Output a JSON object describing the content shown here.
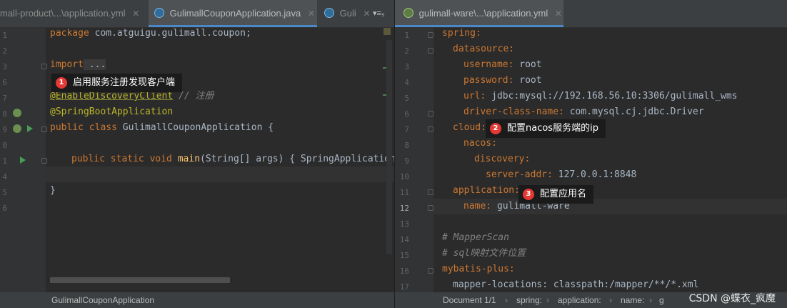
{
  "left_tabs": [
    {
      "label": "mall-product\\...\\application.yml",
      "active": false
    },
    {
      "label": "GulimallCouponApplication.java",
      "active": true
    },
    {
      "label": "Guli",
      "active": false
    }
  ],
  "left_tab_overflow": "▾≡₅",
  "right_tabs": [
    {
      "label": "gulimall-ware\\...\\application.yml",
      "active": true
    }
  ],
  "java": {
    "line_numbers": [
      "1",
      "2",
      "3",
      "6",
      "7",
      "8",
      "9",
      "0",
      "1",
      "4",
      "5",
      "6"
    ],
    "l1_kw": "package",
    "l1_rest": " com.atguigu.gulimall.coupon;",
    "l3_kw": "import",
    "l3_rest": " ...",
    "l7_ann": "@EnableDiscoveryClient",
    "l7_cmt": " // 注册",
    "l8_ann": "@SpringBootApplication",
    "l9_kw": "public class",
    "l9_rest": " GulimallCouponApplication {",
    "l11_kw": "public static void",
    "l11_fn": " main",
    "l11_rest": "(String[] args) { SpringApplication",
    "l13": "}"
  },
  "yml": {
    "line_numbers": [
      "1",
      "2",
      "3",
      "4",
      "5",
      "6",
      "7",
      "8",
      "9",
      "10",
      "11",
      "12",
      "13",
      "14",
      "15",
      "16",
      "17"
    ],
    "l1": "spring:",
    "l2": "datasource:",
    "l3_k": "username:",
    "l3_v": " root",
    "l4_k": "password:",
    "l4_v": " root",
    "l5_k": "url:",
    "l5_v": " jdbc:mysql://192.168.56.10:3306/gulimall_wms",
    "l6_k": "driver-class-name:",
    "l6_v": " com.mysql.cj.jdbc.Driver",
    "l7": "cloud:",
    "l8": "nacos:",
    "l9": "discovery:",
    "l10_k": "server-addr:",
    "l10_v": " 127.0.0.1:8848",
    "l11": "application:",
    "l12_k": "name:",
    "l12_v": " gulimall-ware",
    "l14": "# MapperScan",
    "l15": "# sql映射文件位置",
    "l16": "mybatis-plus:",
    "l17": "mapper-locations: classpath:/mapper/**/*.xml"
  },
  "callouts": [
    {
      "num": "1",
      "text": "启用服务注册发现客户端"
    },
    {
      "num": "2",
      "text": "配置nacos服务端的ip"
    },
    {
      "num": "3",
      "text": "配置应用名"
    }
  ],
  "status_left": "GulimallCouponApplication",
  "status_right": [
    "Document 1/1",
    "spring:",
    "application:",
    "name:",
    "g"
  ],
  "status_sep": "›",
  "watermark": "CSDN @蝶衣_疯魔",
  "colors": {
    "keyword": "#cc7832",
    "annotation": "#bbb529",
    "comment": "#808080",
    "callout_badge": "#e53935"
  }
}
